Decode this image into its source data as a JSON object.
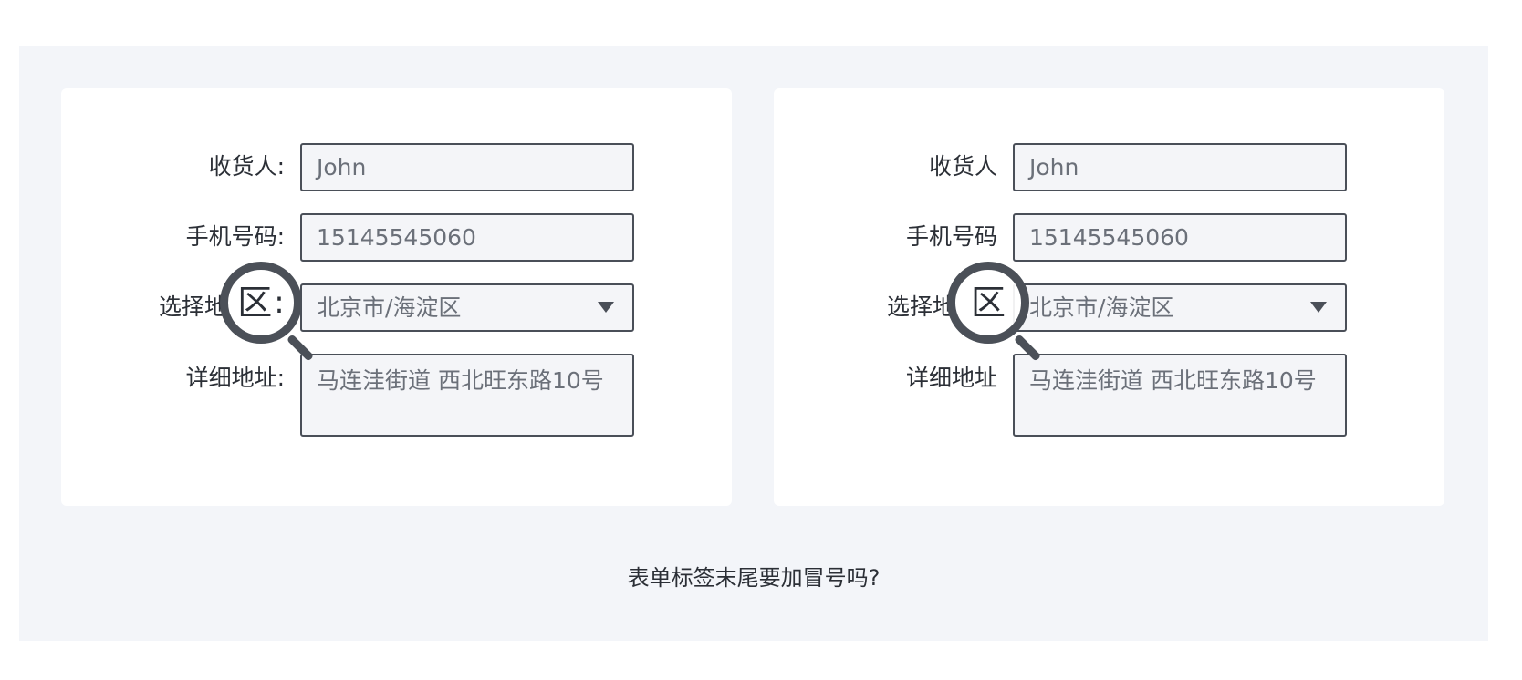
{
  "left_form": {
    "labels": [
      "收货人:",
      "手机号码:",
      "选择地",
      "详细地址:"
    ],
    "magnified_text": "区",
    "magnified_colon": ":",
    "values": {
      "recipient": "John",
      "phone": "15145545060",
      "region": "北京市/海淀区",
      "address": "马连洼街道 西北旺东路10号"
    }
  },
  "right_form": {
    "labels": [
      "收货人",
      "手机号码",
      "选择地",
      "详细地址"
    ],
    "magnified_text": "区",
    "values": {
      "recipient": "John",
      "phone": "15145545060",
      "region": "北京市/海淀区",
      "address": "马连洼街道 西北旺东路10号"
    }
  },
  "question": "表单标签末尾要加冒号吗?",
  "icons": {
    "dropdown": "caret-down-icon",
    "magnifier": "magnifier-icon"
  },
  "colors": {
    "background": "#f3f5f9",
    "card": "#ffffff",
    "border": "#4a4f58"
  }
}
